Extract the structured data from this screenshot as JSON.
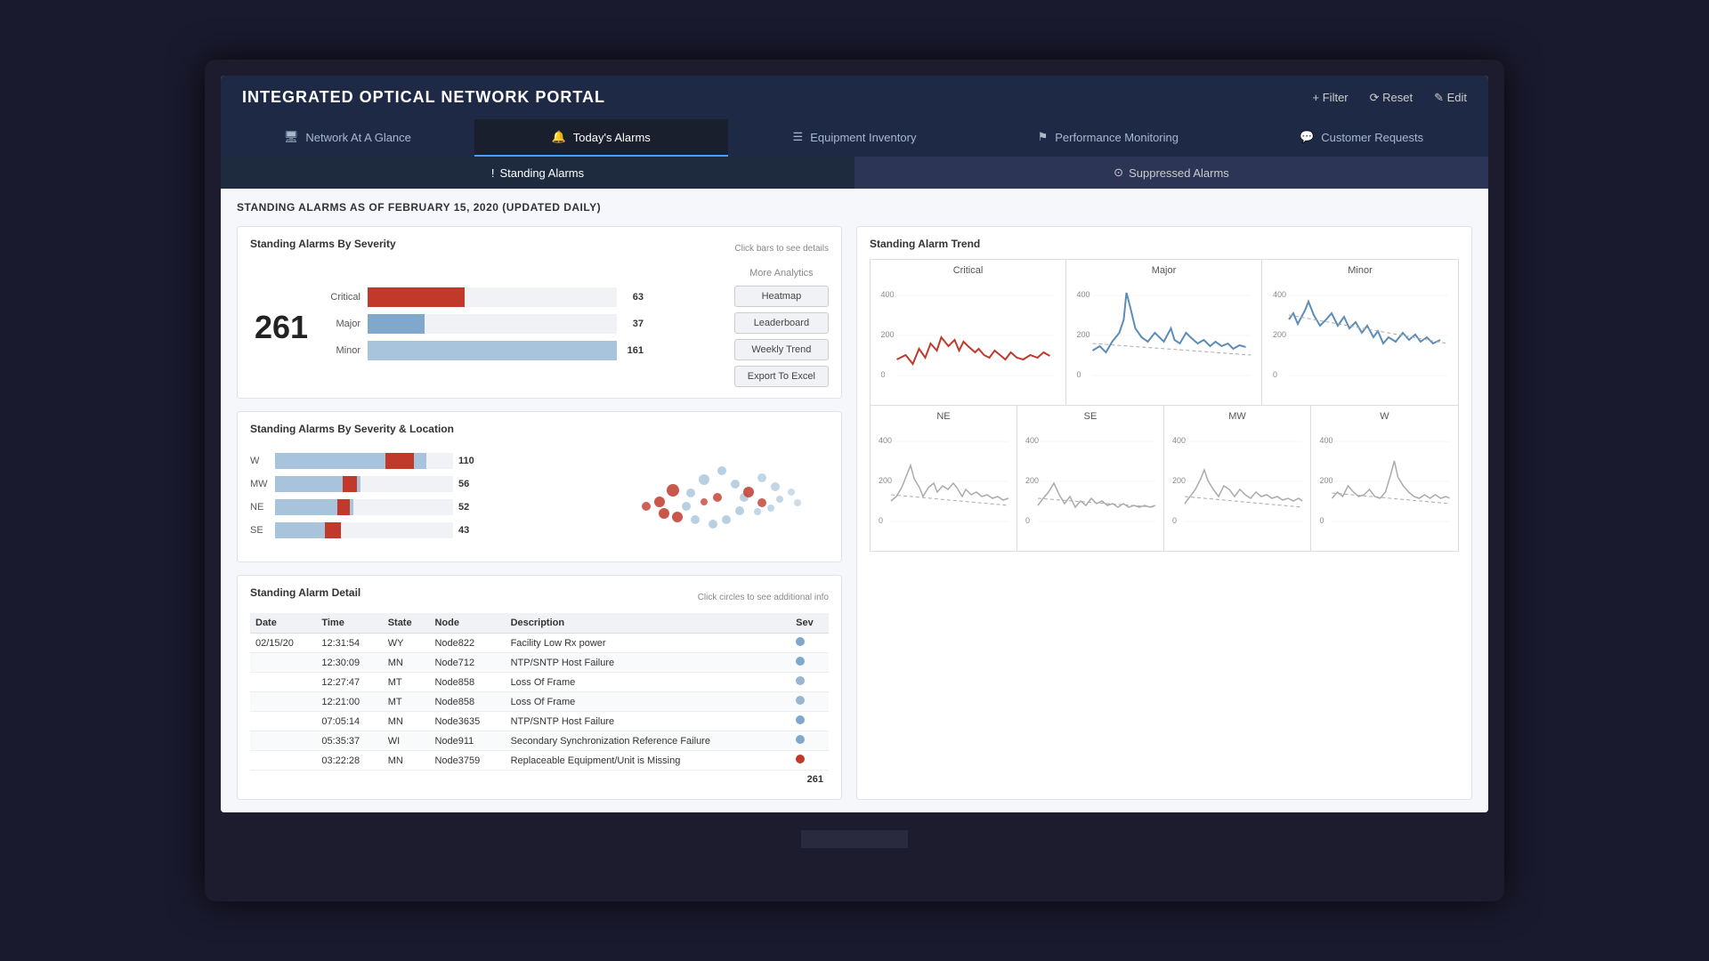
{
  "app": {
    "title": "INTEGRATED OPTICAL NETWORK PORTAL",
    "header_actions": [
      {
        "label": "+ Filter",
        "icon": "filter"
      },
      {
        "label": "⟳ Reset",
        "icon": "reset"
      },
      {
        "label": "✎ Edit",
        "icon": "edit"
      }
    ]
  },
  "nav_tabs": [
    {
      "label": "Network At A Glance",
      "icon": "monitor",
      "active": false
    },
    {
      "label": "Today's Alarms",
      "icon": "bell",
      "active": true
    },
    {
      "label": "Equipment Inventory",
      "icon": "list",
      "active": false
    },
    {
      "label": "Performance Monitoring",
      "icon": "flag",
      "active": false
    },
    {
      "label": "Customer Requests",
      "icon": "chat",
      "active": false
    }
  ],
  "sub_tabs": [
    {
      "label": "! Standing Alarms",
      "active": true
    },
    {
      "label": "⓪ Suppressed Alarms",
      "active": false
    }
  ],
  "standing_alarms": {
    "header": "STANDING ALARMS AS OF FEBRUARY 15, 2020  (Updated Daily)",
    "severity_section": {
      "title": "Standing Alarms By Severity",
      "click_hint": "Click bars to see details",
      "total": "261",
      "bars": [
        {
          "label": "Critical",
          "value": 63,
          "max": 161,
          "color": "critical"
        },
        {
          "label": "Major",
          "value": 37,
          "max": 161,
          "color": "major"
        },
        {
          "label": "Minor",
          "value": 161,
          "max": 161,
          "color": "minor"
        }
      ]
    },
    "analytics": {
      "title": "More Analytics",
      "buttons": [
        "Heatmap",
        "Leaderboard",
        "Weekly Trend",
        "Export To Excel"
      ]
    },
    "location_section": {
      "title": "Standing Alarms By Severity & Location",
      "click_hint": "Click circles to see additional info",
      "locations": [
        {
          "label": "W",
          "value": 110,
          "minor": 80,
          "critical": 20,
          "total_width": 85
        },
        {
          "label": "MW",
          "value": 56,
          "minor": 55,
          "critical": 10,
          "total_width": 55
        },
        {
          "label": "NE",
          "value": 52,
          "minor": 50,
          "critical": 8,
          "total_width": 50
        },
        {
          "label": "SE",
          "value": 43,
          "minor": 42,
          "critical": 12,
          "total_width": 45
        }
      ]
    },
    "detail_section": {
      "title": "Standing Alarm Detail",
      "columns": [
        "Date",
        "Time",
        "State",
        "Node",
        "Description",
        "Sev"
      ],
      "rows": [
        {
          "date": "02/15/20",
          "time": "12:31:54",
          "state": "WY",
          "node": "Node822",
          "desc": "Facility Low Rx power",
          "sev": "minor"
        },
        {
          "date": "",
          "time": "12:30:09",
          "state": "MN",
          "node": "Node712",
          "desc": "NTP/SNTP Host Failure",
          "sev": "minor"
        },
        {
          "date": "",
          "time": "12:27:47",
          "state": "MT",
          "node": "Node858",
          "desc": "Loss Of Frame",
          "sev": "major"
        },
        {
          "date": "",
          "time": "12:21:00",
          "state": "MT",
          "node": "Node858",
          "desc": "Loss Of Frame",
          "sev": "major"
        },
        {
          "date": "",
          "time": "07:05:14",
          "state": "MN",
          "node": "Node3635",
          "desc": "NTP/SNTP Host Failure",
          "sev": "minor"
        },
        {
          "date": "",
          "time": "05:35:37",
          "state": "WI",
          "node": "Node911",
          "desc": "Secondary Synchronization Reference Failure",
          "sev": "minor"
        },
        {
          "date": "",
          "time": "03:22:28",
          "state": "MN",
          "node": "Node3759",
          "desc": "Replaceable Equipment/Unit is Missing",
          "sev": "critical"
        }
      ],
      "total": "261"
    }
  },
  "trend": {
    "title": "Standing Alarm Trend",
    "top_labels": [
      "Critical",
      "Major",
      "Minor"
    ],
    "bottom_labels": [
      "NE",
      "SE",
      "MW",
      "W"
    ]
  },
  "colors": {
    "header_bg": "#1e2a45",
    "nav_active_bg": "#1a1f2e",
    "accent_blue": "#4a9eff",
    "critical_red": "#c0392b",
    "major_blue": "#7fa8cc",
    "minor_lightblue": "#a8c4dc"
  }
}
